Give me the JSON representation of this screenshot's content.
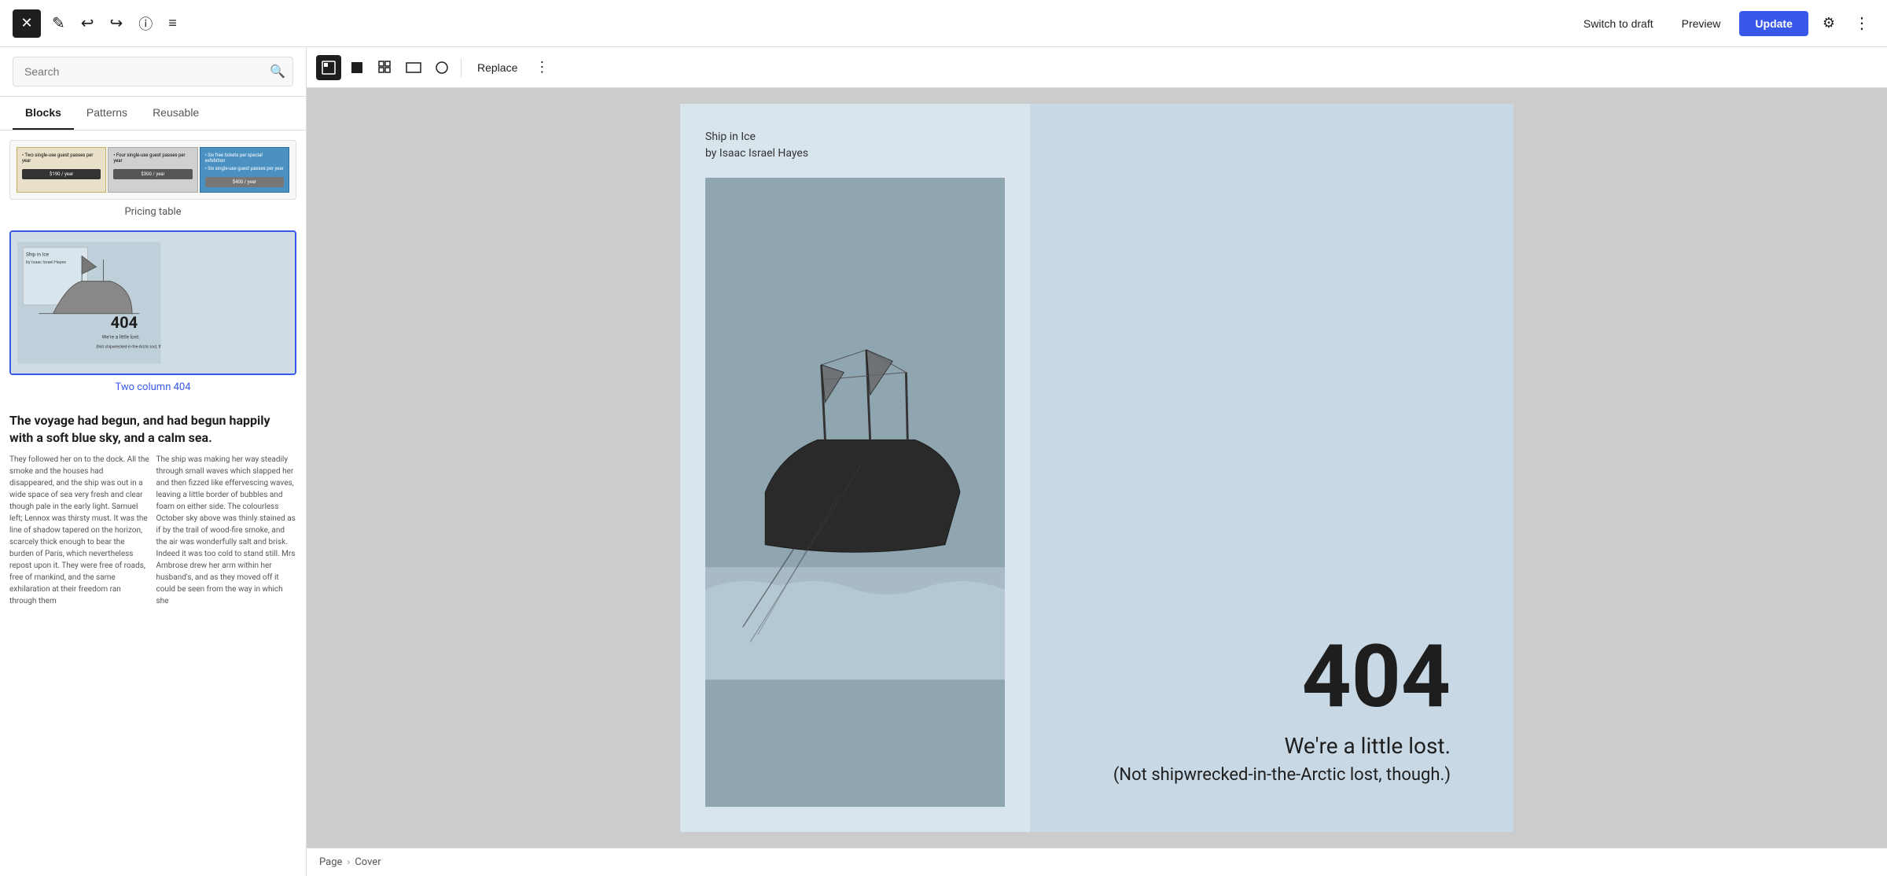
{
  "toolbar": {
    "close_label": "✕",
    "pen_icon": "✏",
    "undo_icon": "↩",
    "redo_icon": "↪",
    "info_icon": "ℹ",
    "menu_icon": "≡",
    "switch_to_draft": "Switch to draft",
    "preview": "Preview",
    "update": "Update",
    "settings_icon": "⚙",
    "more_icon": "⋮"
  },
  "sidebar": {
    "search_placeholder": "Search",
    "search_icon": "🔍",
    "tabs": [
      {
        "id": "blocks",
        "label": "Blocks",
        "active": true
      },
      {
        "id": "patterns",
        "label": "Patterns",
        "active": false
      },
      {
        "id": "reusable",
        "label": "Reusable",
        "active": false
      }
    ],
    "pricing_table": {
      "label": "Pricing table",
      "columns": [
        {
          "price": "$190 / year",
          "color": "#333"
        },
        {
          "price": "$300 / year",
          "color": "#555"
        },
        {
          "price": "$400 / year",
          "color": "#777"
        }
      ]
    },
    "two_column_404": {
      "label": "Two column 404",
      "selected": true,
      "big_number": "404",
      "lost_text": "We're a little lost.",
      "not_ship_text": "(Not shipwrecked-in-the-Arctic lost, though.)"
    },
    "text_preview": {
      "heading": "The voyage had begun, and had begun happily with a soft blue sky, and a calm sea.",
      "col1": "They followed her on to the dock. All the smoke and the houses had disappeared, and the ship was out in a wide space of sea very fresh and clear though pale in the early light. Samuel left; Lennox was thirsty must. It was the line of shadow tapered on the horizon, scarcely thick enough to bear the burden of Paris, which nevertheless repost upon it. They were free of roads, free of mankind, and the same exhilaration at their freedom ran through them",
      "col2": "The ship was making her way steadily through small waves which slapped her and then fizzed like effervescing waves, leaving a little border of bubbles and foam on either side. The colourless October sky above was thinly stained as if by the trail of wood-fire smoke, and the air was wonderfully salt and brisk. Indeed it was too cold to stand still. Mrs Ambrose drew her arm within her husband's, and as they moved off it could be seen from the way in which she"
    }
  },
  "block_toolbar": {
    "cover_icon": "▣",
    "square_icon": "■",
    "grid_icon": "⠿",
    "wide_icon": "⬜",
    "circle_icon": "○",
    "replace_label": "Replace",
    "more_icon": "⋮"
  },
  "canvas": {
    "caption_line1": "Ship in Ice",
    "caption_line2": "by Isaac Israel Hayes",
    "big_404": "404",
    "lost_text": "We're a little lost.",
    "not_ship_text": "(Not shipwrecked-in-the-Arctic lost, though.)"
  },
  "breadcrumb": {
    "items": [
      "Page",
      "Cover"
    ]
  }
}
